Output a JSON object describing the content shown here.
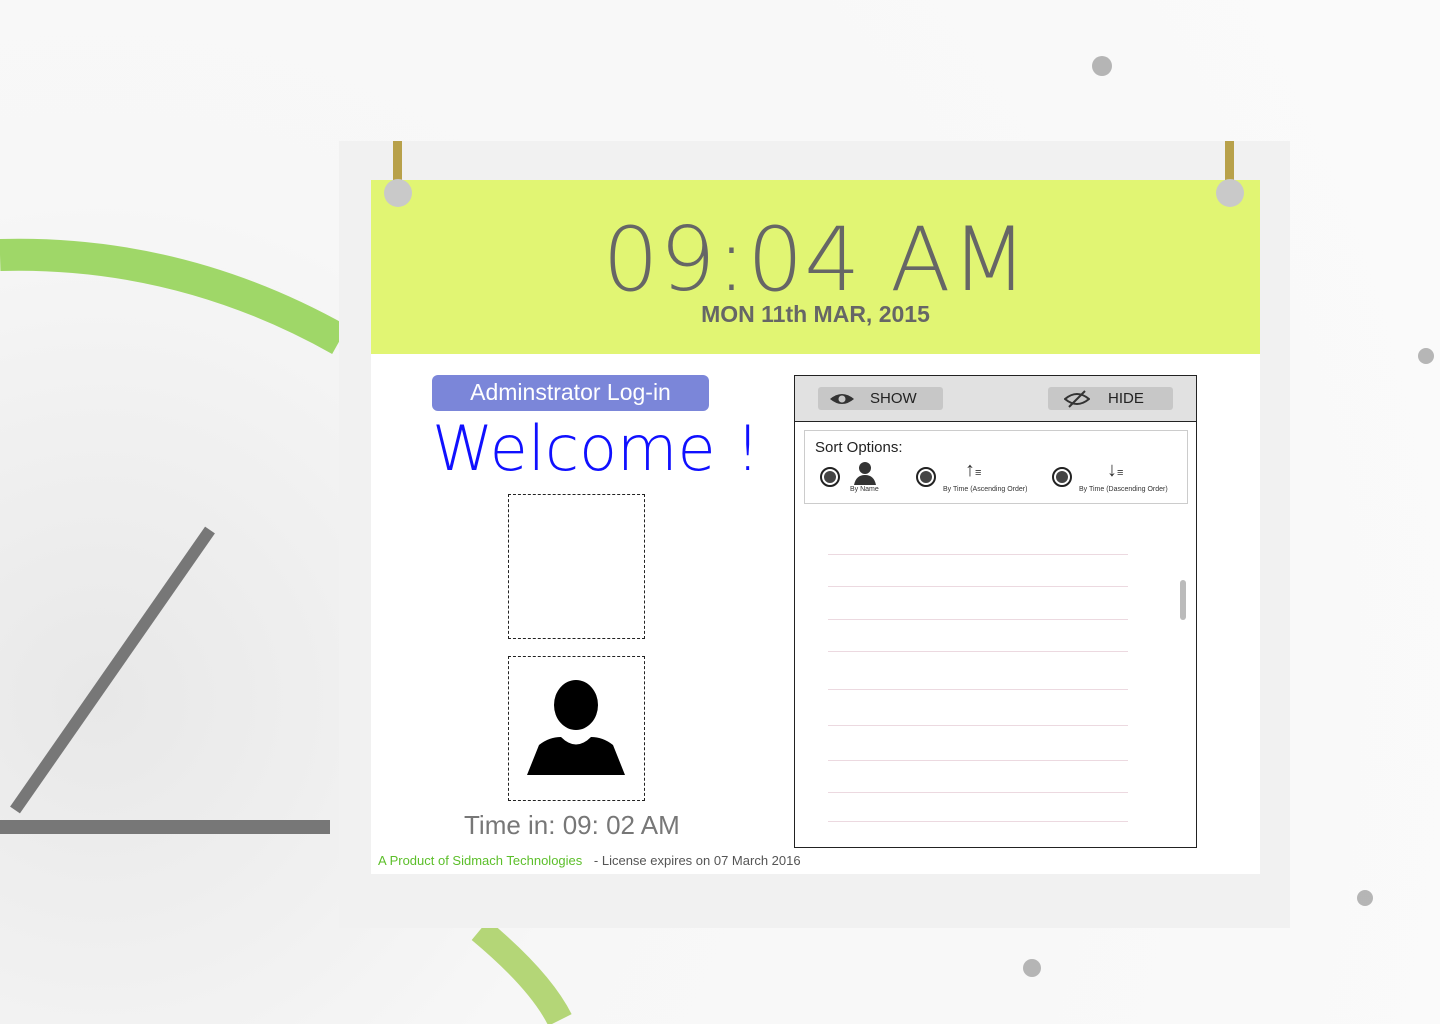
{
  "clock": {
    "time": "09:04 AM",
    "date": "MON 11th MAR, 2015"
  },
  "login": {
    "title": "Adminstrator Log-in",
    "welcome": "Welcome !",
    "time_in": "Time in: 09: 02 AM"
  },
  "footer": {
    "product": "A Product of Sidmach Technologies",
    "license": "- License expires on 07 March 2016"
  },
  "panel": {
    "show_label": "SHOW",
    "hide_label": "HIDE",
    "sort_title": "Sort Options:",
    "sort_options": [
      {
        "label": "By Name",
        "icon": "user-icon"
      },
      {
        "label": "By Time (Ascending Order)",
        "icon": "sort-ascending-icon"
      },
      {
        "label": "By Time (Dascending Order)",
        "icon": "sort-descending-icon"
      }
    ]
  },
  "colors": {
    "header": "#e1f573",
    "login": "#7b86d9",
    "welcome": "#1010ff",
    "product": "#5cbf2a"
  }
}
